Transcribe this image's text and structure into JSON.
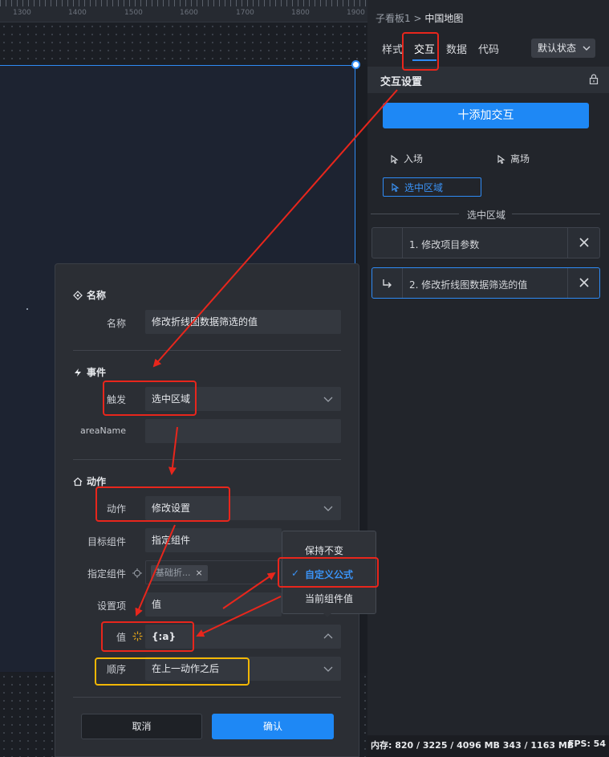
{
  "ruler": {
    "labels": [
      "1300",
      "1400",
      "1500",
      "1600",
      "1700",
      "1800",
      "1900"
    ]
  },
  "panel": {
    "breadcrumb_parent": "子看板1",
    "breadcrumb_sep": ">",
    "breadcrumb_current": "中国地图",
    "tabs": [
      "样式",
      "交互",
      "数据",
      "代码"
    ],
    "active_tab": "交互",
    "state_select": "默认状态",
    "section_title": "交互设置",
    "add_button": "十添加交互",
    "events": {
      "enter": "入场",
      "leave": "离场",
      "select_region": "选中区域"
    },
    "list_title": "选中区域",
    "actions": [
      {
        "label": "1. 修改项目参数"
      },
      {
        "label": "2. 修改折线图数据筛选的值"
      }
    ]
  },
  "status": {
    "memory": "内存:  820 / 3225 / 4096 MB  343 / 1163 MB",
    "fps": "FPS:  54"
  },
  "dialog": {
    "name_section": "名称",
    "name_label": "名称",
    "name_value": "修改折线图数据筛选的值",
    "event_section": "事件",
    "trigger_label": "触发",
    "trigger_value": "选中区域",
    "areaname_label": "areaName",
    "areaname_value": "",
    "action_section": "动作",
    "action_label": "动作",
    "action_value": "修改设置",
    "target_label": "目标组件",
    "target_value": "指定组件",
    "specified_label": "指定组件",
    "specified_tag": "基础折...",
    "specified_tag_close": "×",
    "setting_label": "设置项",
    "setting_value": "值",
    "value_label": "值",
    "value_value": "{:a}",
    "order_label": "顺序",
    "order_value": "在上一动作之后",
    "cancel": "取消",
    "confirm": "确认"
  },
  "popup": {
    "options": [
      "保持不变",
      "自定义公式",
      "当前组件值"
    ],
    "selected": "自定义公式",
    "check": "✓"
  },
  "colors": {
    "accent": "#1e88f5",
    "annotation_red": "#e8261c",
    "annotation_yellow": "#f2b705",
    "panel_bg": "#22252b",
    "dialog_bg": "#2b2e34"
  }
}
